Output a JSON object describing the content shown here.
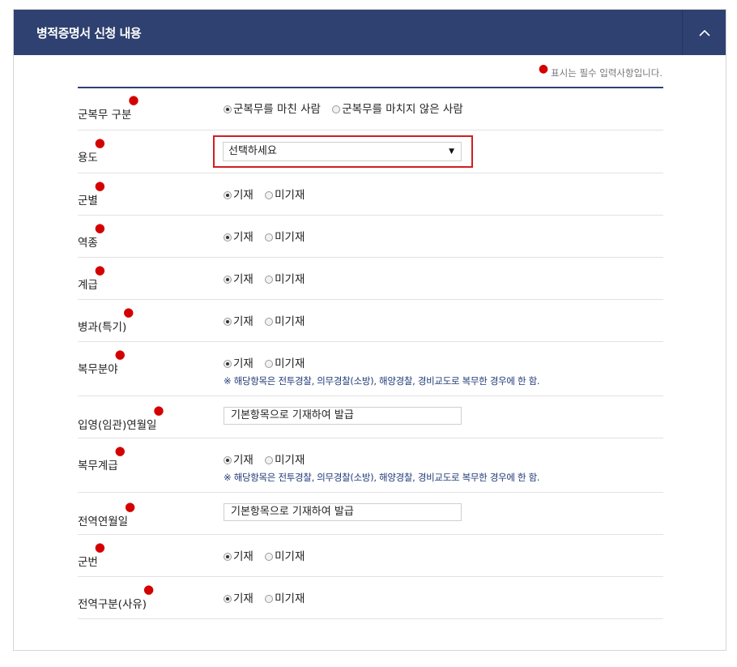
{
  "header": {
    "title": "병적증명서 신청 내용",
    "collapse_icon": "chevron-up-icon"
  },
  "required_note": "표시는 필수 입력사항입니다.",
  "rows": {
    "service_type": {
      "label": "군복무 구분",
      "option1": "군복무를 마친 사람",
      "option2": "군복무를 마치지 않은 사람",
      "selected": "option1"
    },
    "purpose": {
      "label": "용도",
      "select_value": "선택하세요"
    },
    "branch": {
      "label": "군별",
      "on": "기재",
      "off": "미기재"
    },
    "service_class": {
      "label": "역종",
      "on": "기재",
      "off": "미기재"
    },
    "rank": {
      "label": "계급",
      "on": "기재",
      "off": "미기재"
    },
    "specialty": {
      "label": "병과(특기)",
      "on": "기재",
      "off": "미기재"
    },
    "service_field": {
      "label": "복무분야",
      "on": "기재",
      "off": "미기재",
      "note": "※ 해당항목은 전투경찰, 의무경찰(소방), 해양경찰, 경비교도로 복무한 경우에 한 함."
    },
    "enlist_date": {
      "label": "입영(임관)연월일",
      "value": "기본항목으로 기재하여 발급"
    },
    "service_rank": {
      "label": "복무계급",
      "on": "기재",
      "off": "미기재",
      "note": "※ 해당항목은 전투경찰, 의무경찰(소방), 해양경찰, 경비교도로 복무한 경우에 한 함."
    },
    "discharge_date": {
      "label": "전역연월일",
      "value": "기본항목으로 기재하여 발급"
    },
    "service_number": {
      "label": "군번",
      "on": "기재",
      "off": "미기재"
    },
    "discharge_type": {
      "label": "전역구분(사유)",
      "on": "기재",
      "off": "미기재"
    }
  },
  "colors": {
    "header_bg": "#2e4170",
    "required_dot": "#d40000",
    "highlight_border": "#d21d23",
    "note_text": "#1f3a78"
  }
}
